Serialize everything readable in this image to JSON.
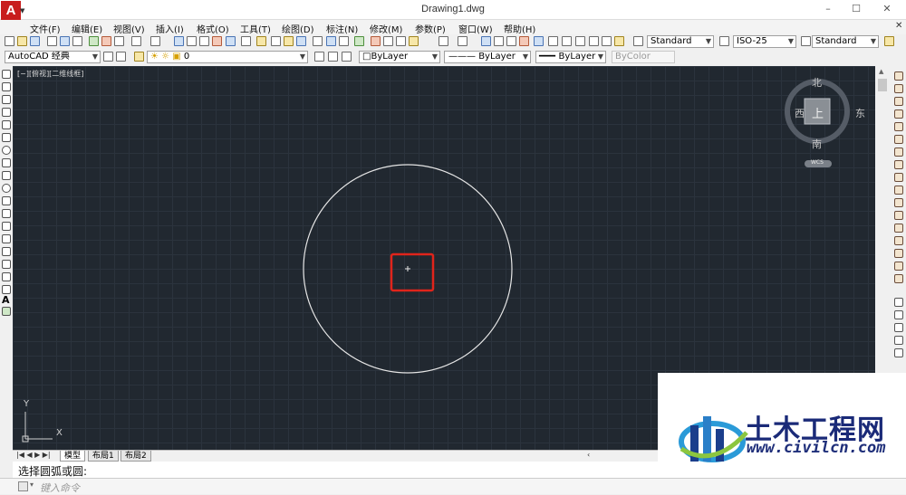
{
  "app": {
    "logo_letter": "A",
    "title": "Drawing1.dwg"
  },
  "window_controls": {
    "minimize": "–",
    "maximize": "☐",
    "close": "✕"
  },
  "menu": {
    "items": [
      "文件(F)",
      "编辑(E)",
      "视图(V)",
      "插入(I)",
      "格式(O)",
      "工具(T)",
      "绘图(D)",
      "标注(N)",
      "修改(M)",
      "参数(P)",
      "窗口(W)",
      "帮助(H)"
    ],
    "close_glyph": "✕"
  },
  "styles": {
    "text_style": "Standard",
    "dim_style": "ISO-25",
    "table_style": "Standard"
  },
  "workspace": {
    "name": "AutoCAD 经典"
  },
  "layer": {
    "current": "0"
  },
  "properties": {
    "color": "ByLayer",
    "linetype": "ByLayer",
    "lineweight": "ByLayer",
    "plotstyle": "ByColor"
  },
  "viewport": {
    "label": "[−][俯视][二维线框]",
    "ucs_x": "X",
    "ucs_y": "Y"
  },
  "viewcube": {
    "north": "北",
    "south": "南",
    "east": "东",
    "west": "西",
    "face": "上",
    "wcs": "WCS"
  },
  "layout_tabs": {
    "items": [
      "模型",
      "布局1",
      "布局2"
    ],
    "active": "模型"
  },
  "command": {
    "prompt": "选择圆弧或圆:",
    "placeholder": "键入命令"
  },
  "watermark": {
    "title": "土木工程网",
    "url": "www.civilcn.com"
  },
  "colors": {
    "canvas": "#212830",
    "highlight": "#e0241b",
    "logo_red": "#c81d1d",
    "watermark_blue": "#1a2a78"
  }
}
